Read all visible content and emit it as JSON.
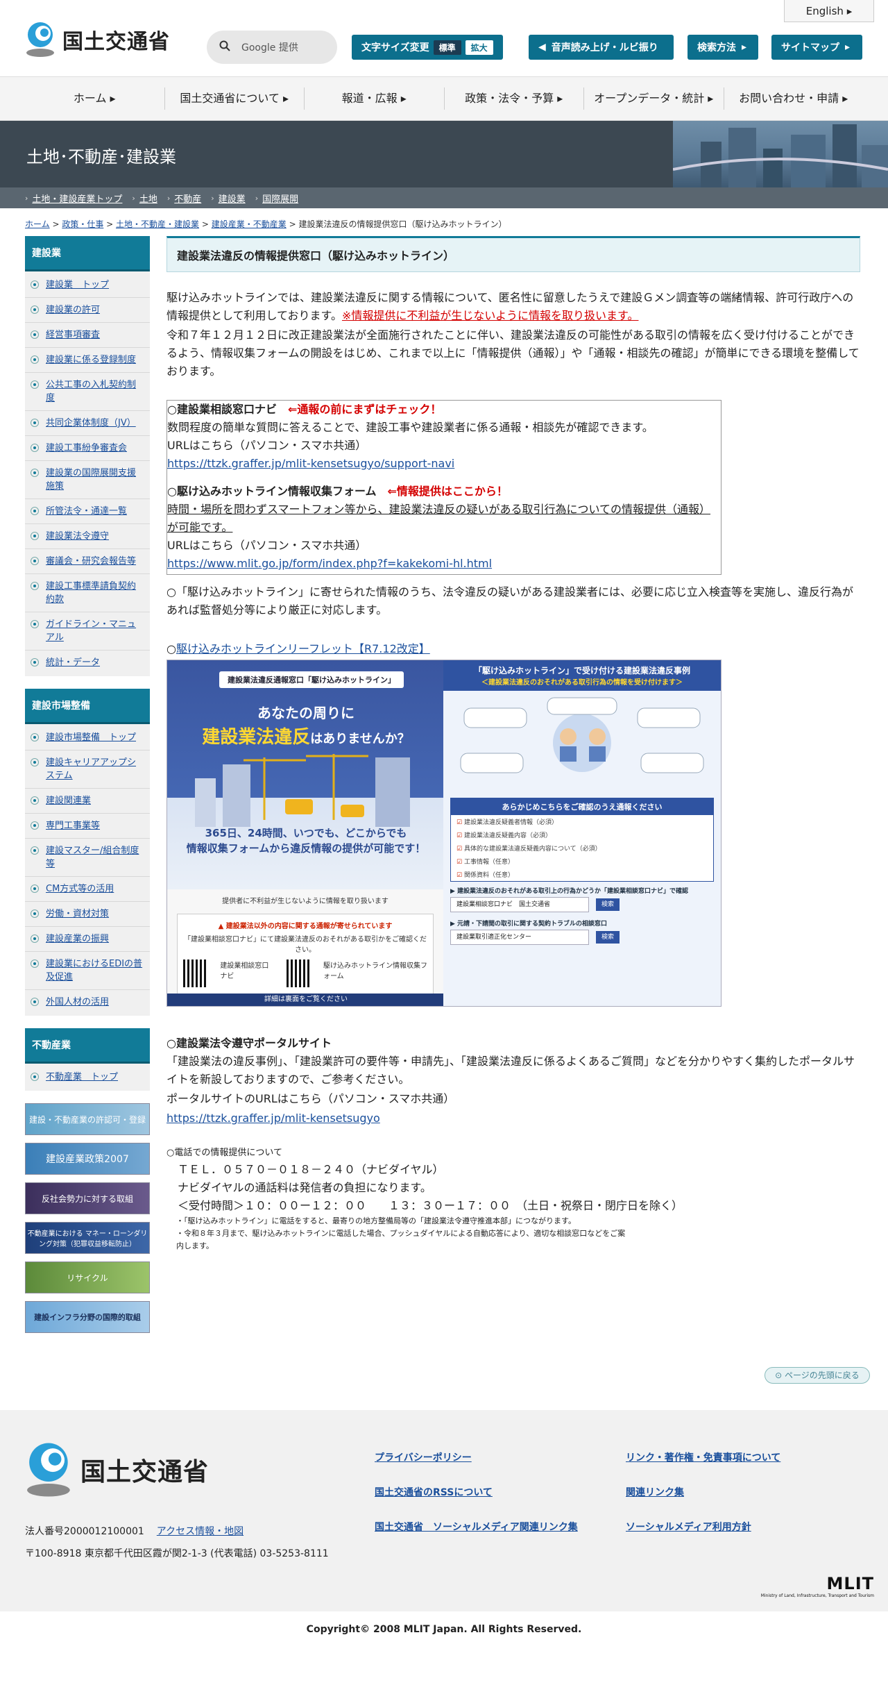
{
  "header": {
    "logo_text": "国土交通省",
    "lang_label": "English",
    "search_placeholder": "Google 提供",
    "font_size_label": "文字サイズ変更",
    "font_standard": "標準",
    "font_large": "拡大",
    "voice_label": "音声読み上げ・ルビ振り",
    "search_method": "検索方法",
    "sitemap": "サイトマップ"
  },
  "gnav": [
    "ホーム",
    "国土交通省について",
    "報道・広報",
    "政策・法令・予算",
    "オープンデータ・統計",
    "お問い合わせ・申請"
  ],
  "banner": {
    "title": "土地･不動産･建設業",
    "subnav": [
      "土地・建設産業トップ",
      "土地",
      "不動産",
      "建設業",
      "国際展開"
    ]
  },
  "breadcrumb": {
    "links": [
      "ホーム",
      "政策・仕事",
      "土地・不動産・建設業",
      "建設産業・不動産業"
    ],
    "current": "建設業法違反の情報提供窓口（駆け込みホットライン）"
  },
  "sidebar": {
    "construction_head": "建設業",
    "construction_items": [
      "建設業　トップ",
      "建設業の許可",
      "経営事項審査",
      "建設業に係る登録制度",
      "公共工事の入札契約制度",
      "共同企業体制度（JV）",
      "建設工事紛争審査会",
      "建設業の国際展開支援施策",
      "所管法令・通達一覧",
      "建設業法令遵守",
      "審議会・研究会報告等",
      "建設工事標準請負契約約款",
      "ガイドライン・マニュアル",
      "統計・データ"
    ],
    "market_head": "建設市場整備",
    "market_items": [
      "建設市場整備　トップ",
      "建設キャリアアップシステム",
      "建設関連業",
      "専門工事業等",
      "建設マスター/組合制度等",
      "CM方式等の活用",
      "労働・資材対策",
      "建設産業の振興",
      "建設業におけるEDIの普及促進",
      "外国人材の活用"
    ],
    "realestate_head": "不動産業",
    "realestate_items": [
      "不動産業　トップ"
    ],
    "banners": [
      "建設・不動産業の許認可・登録",
      "建設産業政策2007",
      "反社会勢力に対する取組",
      "不動産業における マネー・ローンダリング対策（犯罪収益移転防止）",
      "リサイクル",
      "建設インフラ分野の国際的取組"
    ]
  },
  "main": {
    "title": "建設業法違反の情報提供窓口（駆け込みホットライン）",
    "intro1": "駆け込みホットラインでは、建設業法違反に関する情報について、匿名性に留意したうえで建設Ｇメン調査等の端緒情報、許可行政庁への情報提供として利用しております。",
    "intro1_red": "※情報提供に不利益が生じないように情報を取り扱います。",
    "intro2": "令和７年１２月１２日に改正建設業法が全面施行されたことに伴い、建設業法違反の可能性がある取引の情報を広く受け付けることができるよう、情報収集フォームの開設をはじめ、これまで以上に「情報提供（通報）」や「通報・相談先の確認」が簡単にできる環境を整備しております。",
    "navi_title": "○建設業相談窓口ナビ",
    "navi_arrow": "⇐通報の前にまずはチェック！",
    "navi_desc": "数問程度の簡単な質問に答えることで、建設工事や建設業者に係る通報・相談先が確認できます。",
    "url_note": "URLはこちら（パソコン・スマホ共通）",
    "navi_url": "https://ttzk.graffer.jp/mlit-kensetsugyo/support-navi",
    "form_title": "○駆け込みホットライン情報収集フォーム",
    "form_arrow": "⇐情報提供はここから！",
    "form_desc": "時間・場所を問わずスマートフォン等から、建設業法違反の疑いがある取引行為についての情報提供（通報）が可能です。",
    "form_url": "https://www.mlit.go.jp/form/index.php?f=kakekomi-hl.html",
    "after_note": "○「駆け込みホットライン」に寄せられた情報のうち、法令違反の疑いがある建設業者には、必要に応じ立入検査等を実施し、違反行為があれば監督処分等により厳正に対応します。",
    "leaflet_link": "駆け込みホットラインリーフレット【R7.12改定】",
    "portal_title": "○建設業法令遵守ポータルサイト",
    "portal_desc": "「建設業法の違反事例」、「建設業許可の要件等・申請先」、「建設業法違反に係るよくあるご質問」などを分かりやすく集約したポータルサイトを新設しておりますので、ご参考ください。",
    "portal_url_note": "ポータルサイトのURLはこちら（パソコン・スマホ共通）",
    "portal_url": "https://ttzk.graffer.jp/mlit-kensetsugyo",
    "phone_head": "○電話での情報提供について",
    "phone_tel": "ＴＥＬ．０５７０－０１８－２４０（ナビダイヤル）",
    "phone_fee": "ナビダイヤルの通話料は発信者の負担になります。",
    "phone_hours": "＜受付時間＞１０：００ー１２：００　　１３：３０ー１７：００　（土日・祝祭日・閉庁日を除く）",
    "phone_note1": "・「駆け込みホットライン」に電話をすると、最寄りの地方整備局等の「建設業法令遵守推進本部」につながります。",
    "phone_note2": "・令和８年３月まで、駆け込みホットラインに電話した場合、プッシュダイヤルによる自動応答により、適切な相談窓口などをご案内します。"
  },
  "leaflet": {
    "pill": "建設業法違反通報窓口「駆け込みホットライン」",
    "q1": "あなたの周りに",
    "q2": "建設業法違反",
    "q2_tail": "はありませんか？",
    "info1": "365日、24時間、いつでも、どこからでも",
    "info2": "情報収集フォームから違反情報の提供が可能です！",
    "note": "提供者に不利益が生じないように情報を取り扱います",
    "card_head": "▲ 建設業法以外の内容に関する通報が寄せられています",
    "card_line": "「建設業相談窓口ナビ」にて建設業法違反のおそれがある取引かをご確認ください。",
    "qr1": "建設業相談窓口ナビ",
    "qr2": "駆け込みホットライン情報収集フォーム",
    "foot": "詳細は裏面をご覧ください",
    "r_head": "「駆け込みホットライン」で受け付ける建設業法違反事例",
    "r_sub": "＜建設業法違反のおそれがある取引行為の情報を受け付けます＞",
    "check_head": "あらかじめこちらをご確認のうえ通報ください",
    "checks": [
      "建設業法違反疑義者情報（必須）",
      "建設業法違反疑義内容（必須）",
      "具体的な建設業法違反疑義内容について（必須）",
      "工事情報（任意）",
      "関係資料（任意）"
    ],
    "bar1": "▶ 建設業法違反のおそれがある取引上の行為かどうか「建設業相談窓口ナビ」で確認",
    "input1": "建設業相談窓口ナビ　国土交通省",
    "bar2": "▶ 元請・下請間の取引に関する契約トラブルの相談窓口",
    "input2": "建設業取引適正化センター",
    "btn": "検索"
  },
  "footer": {
    "to_top": "ページの先頭に戻る",
    "logo_text": "国土交通省",
    "corp_no": "法人番号2000012100001",
    "access": "アクセス情報・地図",
    "address": "〒100-8918 東京都千代田区霞が関2-1-3 (代表電話) 03-5253-8111",
    "links": [
      "プライバシーポリシー",
      "リンク・著作権・免責事項について",
      "国土交通省のRSSについて",
      "関連リンク集",
      "国土交通省　ソーシャルメディア関連リンク集",
      "ソーシャルメディア利用方針"
    ],
    "mlit": "MLIT",
    "mlit_sub": "Ministry of Land, Infrastructure, Transport and Tourism",
    "copyright": "Copyright© 2008 MLIT Japan. All Rights Reserved."
  },
  "colors": {
    "accent": "#117b98",
    "link": "#1a4f9c",
    "alert": "#d40000"
  }
}
